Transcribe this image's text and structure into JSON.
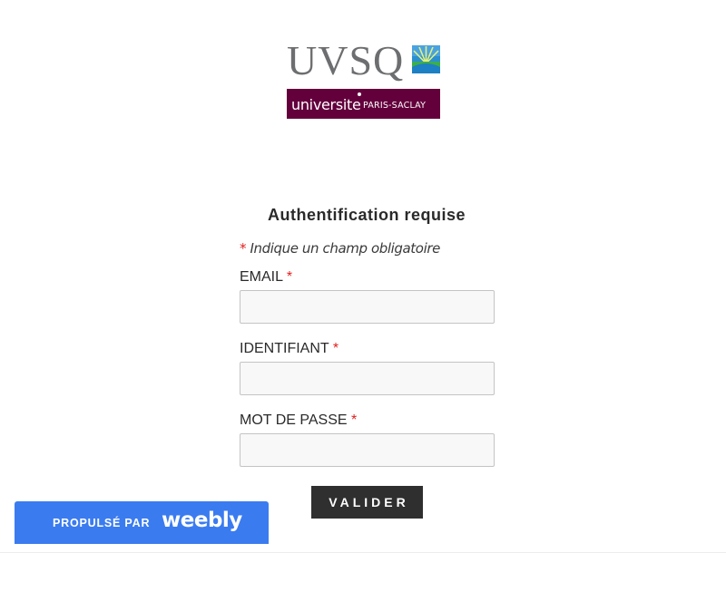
{
  "logo": {
    "uvsq": "UVSQ",
    "partner_main": "universite",
    "partner_sub": "PARIS-SACLAY",
    "colors": {
      "uvsq_gray": "#6d6e70",
      "saclay_purple": "#63003c"
    }
  },
  "form": {
    "title": "Authentification requise",
    "required_marker": "*",
    "required_note": "Indique un champ obligatoire",
    "fields": [
      {
        "label": "EMAIL",
        "value": "",
        "placeholder": ""
      },
      {
        "label": "IDENTIFIANT",
        "value": "",
        "placeholder": ""
      },
      {
        "label": "MOT DE PASSE",
        "value": "",
        "placeholder": ""
      }
    ],
    "submit_label": "VALIDER",
    "colors": {
      "required_star": "#e02020",
      "button_bg": "#2f2f2f"
    }
  },
  "badge": {
    "prefix": "PROPULSÉ PAR",
    "brand": "weebly",
    "color": "#3a7bf0"
  }
}
